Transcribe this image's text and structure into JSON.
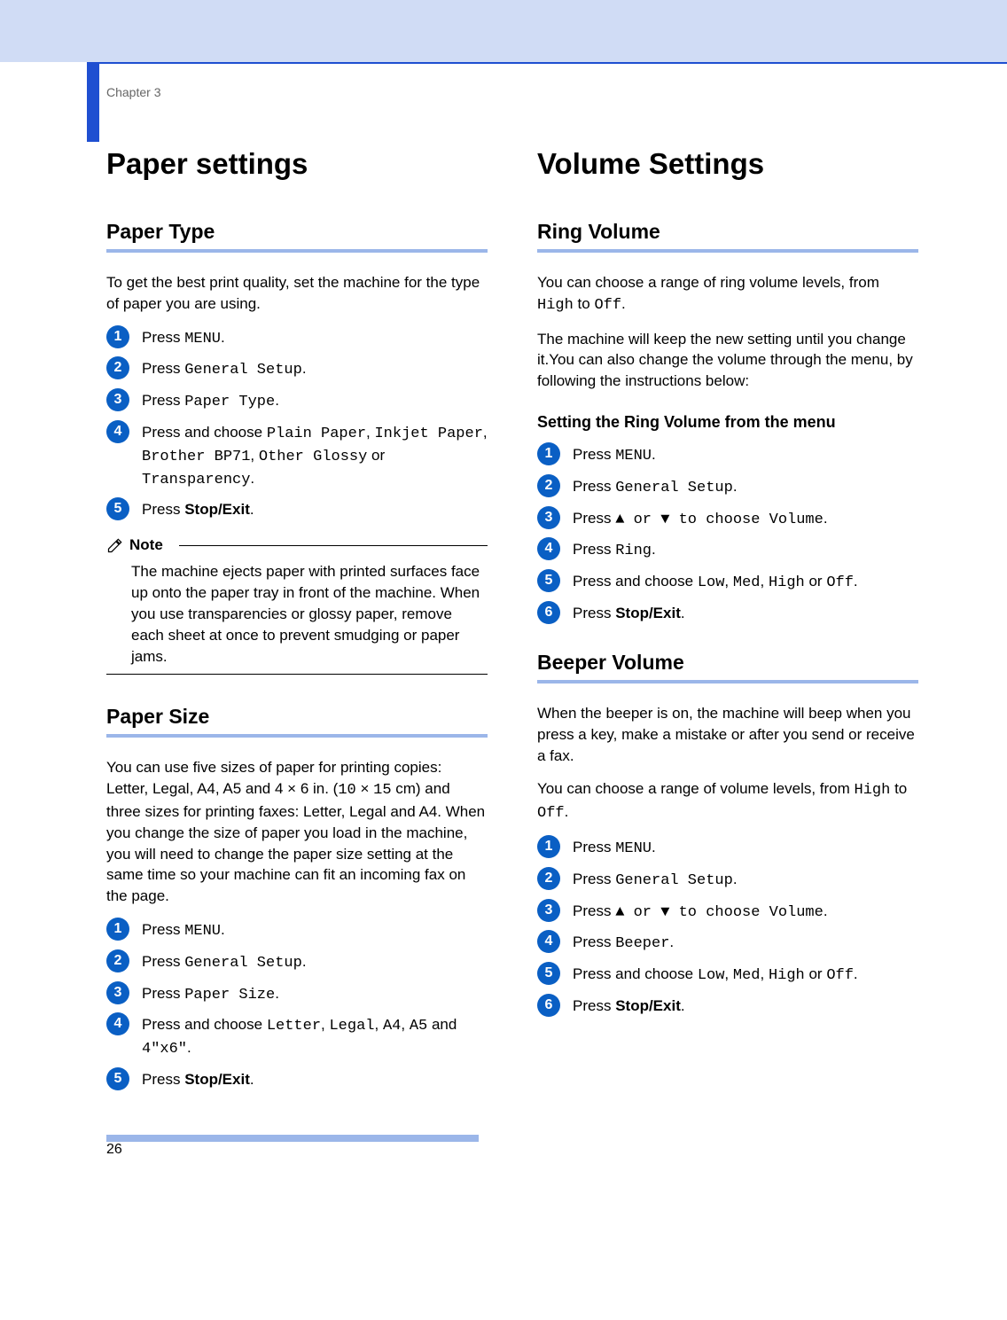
{
  "chapter": "Chapter 3",
  "page_number": "26",
  "left": {
    "h1": "Paper settings",
    "paper_type": {
      "h2": "Paper Type",
      "intro": "To get the best print quality, set the machine for the type of paper you are using.",
      "steps": {
        "s1a": "Press ",
        "s1b": "MENU",
        "s1c": ".",
        "s2a": "Press ",
        "s2b": "General Setup",
        "s2c": ".",
        "s3a": "Press ",
        "s3b": "Paper Type",
        "s3c": ".",
        "s4a": "Press and choose ",
        "s4b": "Plain Paper",
        "s4c": ", ",
        "s4d": "Inkjet Paper",
        "s4e": ", ",
        "s4f": "Brother BP71",
        "s4g": ", ",
        "s4h": "Other Glossy",
        "s4i": " or ",
        "s4j": "Transparency",
        "s4k": ".",
        "s5a": "Press ",
        "s5b": "Stop/Exit",
        "s5c": "."
      },
      "note_label": "Note",
      "note_body": "The machine ejects paper with printed surfaces face up onto the paper tray in front of the machine. When you use transparencies or glossy paper, remove each sheet at once to prevent smudging or paper jams."
    },
    "paper_size": {
      "h2": "Paper Size",
      "intro_a": "You can use five sizes of paper for printing copies: Letter, Legal, A4, A5 and 4 × 6 in. (",
      "intro_b": "10",
      "intro_c": " × ",
      "intro_d": "15",
      "intro_e": " cm) and three sizes for printing faxes: Letter, Legal and A4. When you change the size of paper you load in the machine, you will need to change the paper size setting at the same time so your machine can fit an incoming fax on the page.",
      "steps": {
        "s1a": "Press ",
        "s1b": "MENU",
        "s1c": ".",
        "s2a": "Press ",
        "s2b": "General Setup",
        "s2c": ".",
        "s3a": "Press ",
        "s3b": "Paper Size",
        "s3c": ".",
        "s4a": "Press and choose ",
        "s4b": "Letter",
        "s4c": ", ",
        "s4d": "Legal",
        "s4e": ", ",
        "s4f": "A4",
        "s4g": ", ",
        "s4h": "A5",
        "s4i": " and ",
        "s4j": "4\"x6\"",
        "s4k": ".",
        "s5a": "Press ",
        "s5b": "Stop/Exit",
        "s5c": "."
      }
    }
  },
  "right": {
    "h1": "Volume Settings",
    "ring": {
      "h2": "Ring Volume",
      "intro_a": "You can choose a range of ring volume levels, from ",
      "intro_b": "High",
      "intro_c": " to ",
      "intro_d": "Off",
      "intro_e": ".",
      "intro2": "The machine will keep the new setting until you change it.You can also change the volume through the menu, by following the instructions below:",
      "h3": "Setting the Ring Volume from the menu",
      "steps": {
        "s1a": "Press ",
        "s1b": "MENU",
        "s1c": ".",
        "s2a": "Press ",
        "s2b": "General Setup",
        "s2c": ".",
        "s3a": "Press ",
        "s3b": "▲",
        "s3c": " or ",
        "s3d": "▼",
        "s3e": " to choose ",
        "s3f": "Volume",
        "s3g": ".",
        "s4a": "Press ",
        "s4b": "Ring",
        "s4c": ".",
        "s5a": "Press and choose ",
        "s5b": "Low",
        "s5c": ", ",
        "s5d": "Med",
        "s5e": ", ",
        "s5f": "High",
        "s5g": " or ",
        "s5h": "Off",
        "s5i": ".",
        "s6a": "Press ",
        "s6b": "Stop/Exit",
        "s6c": "."
      }
    },
    "beeper": {
      "h2": "Beeper Volume",
      "intro": "When the beeper is on, the machine will beep when you press a key, make a mistake or after you send or receive a fax.",
      "intro2a": "You can choose a range of volume levels, from ",
      "intro2b": "High",
      "intro2c": " to ",
      "intro2d": "Off",
      "intro2e": ".",
      "steps": {
        "s1a": "Press ",
        "s1b": "MENU",
        "s1c": ".",
        "s2a": "Press ",
        "s2b": "General Setup",
        "s2c": ".",
        "s3a": "Press ",
        "s3b": "▲",
        "s3c": " or ",
        "s3d": "▼",
        "s3e": " to choose ",
        "s3f": "Volume",
        "s3g": ".",
        "s4a": "Press ",
        "s4b": "Beeper",
        "s4c": ".",
        "s5a": "Press and choose ",
        "s5b": "Low",
        "s5c": ", ",
        "s5d": "Med",
        "s5e": ", ",
        "s5f": "High",
        "s5g": " or ",
        "s5h": "Off",
        "s5i": ".",
        "s6a": "Press ",
        "s6b": "Stop/Exit",
        "s6c": "."
      }
    }
  }
}
